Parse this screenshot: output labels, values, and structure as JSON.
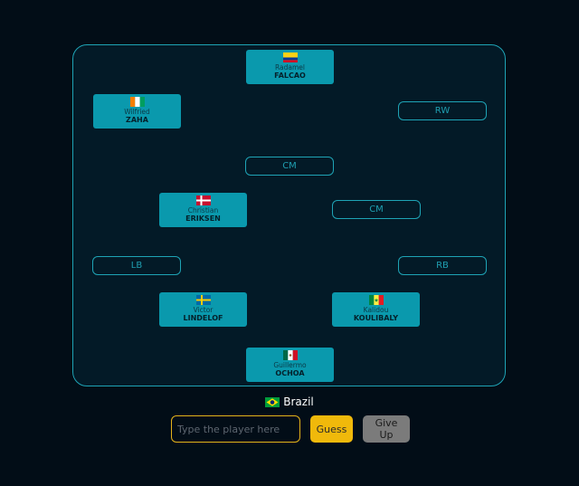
{
  "positions": {
    "st": {
      "first": "Radamel",
      "last": "FALCAO",
      "flag": "colombia-flag-icon"
    },
    "lw": {
      "first": "Wilfried",
      "last": "ZAHA",
      "flag": "ivory-coast-flag-icon"
    },
    "rw": {
      "label": "RW"
    },
    "cm_right_top": {
      "label": "CM"
    },
    "cm_left": {
      "first": "Christian",
      "last": "ERIKSEN",
      "flag": "denmark-flag-icon"
    },
    "cm_right": {
      "label": "CM"
    },
    "lb": {
      "label": "LB"
    },
    "rb": {
      "label": "RB"
    },
    "cb_left": {
      "first": "Victor",
      "last": "LINDELOF",
      "flag": "sweden-flag-icon"
    },
    "cb_right": {
      "first": "Kalidou",
      "last": "KOULIBALY",
      "flag": "senegal-flag-icon"
    },
    "gk": {
      "first": "Guillermo",
      "last": "OCHOA",
      "flag": "mexico-flag-icon"
    }
  },
  "country": {
    "name": "Brazil",
    "flag": "brazil-flag-icon"
  },
  "guess_input": {
    "placeholder": "Type the player here",
    "value": ""
  },
  "buttons": {
    "guess": "Guess",
    "give_up": "Give Up"
  },
  "colors": {
    "accent": "#1ea3b5",
    "filled_slot": "#0a99ad",
    "guess_button": "#f0b90b",
    "give_up_button": "#7b7b7b"
  }
}
